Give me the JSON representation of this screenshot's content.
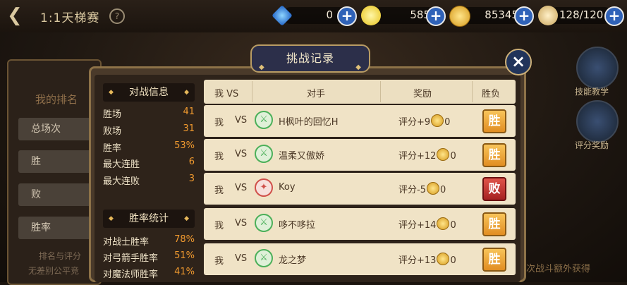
{
  "header": {
    "back_icon": "back-arrow-icon",
    "title": "1:1天梯赛",
    "help_label": "?"
  },
  "resources": [
    {
      "icon": "diamond-icon",
      "value": "0",
      "plus": "+"
    },
    {
      "icon": "energy-swirl-icon",
      "value": "585",
      "plus": "+"
    },
    {
      "icon": "gold-coin-icon",
      "value": "85345",
      "plus": "+"
    },
    {
      "icon": "stamina-flame-icon",
      "value": "128/120",
      "plus": "+"
    }
  ],
  "left_panel": {
    "my_rank": "我的排名",
    "buttons": [
      "总场次",
      "胜",
      "败",
      "胜率"
    ],
    "footer": [
      "排名与评分",
      "无差别公平竞"
    ]
  },
  "right_panel": {
    "skill_label": "技能教学",
    "reward_label": "评分奖励",
    "footer": "次战斗额外获得"
  },
  "modal": {
    "title": "挑战记录",
    "close_label": "×",
    "battle_info": {
      "heading": "对战信息",
      "rows": [
        {
          "label": "胜场",
          "value": "41"
        },
        {
          "label": "败场",
          "value": "31"
        },
        {
          "label": "胜率",
          "value": "53%"
        },
        {
          "label": "最大连胜",
          "value": "6"
        },
        {
          "label": "最大连败",
          "value": "3"
        }
      ]
    },
    "winrate_stats": {
      "heading": "胜率统计",
      "rows": [
        {
          "label": "对战士胜率",
          "value": "78%"
        },
        {
          "label": "对弓箭手胜率",
          "value": "51%"
        },
        {
          "label": "对魔法师胜率",
          "value": "41%"
        }
      ]
    },
    "table": {
      "headers": [
        "我 VS",
        "对手",
        "奖励",
        "胜负"
      ],
      "rows": [
        {
          "me": "我",
          "vs": "VS",
          "class_icon": "warrior-class-icon",
          "opponent": "H枫叶的回忆H",
          "reward_prefix": "评分+9",
          "reward_suffix": "0",
          "result": "胜",
          "result_type": "win"
        },
        {
          "me": "我",
          "vs": "VS",
          "class_icon": "warrior-class-icon",
          "opponent": "温柔又傲娇",
          "reward_prefix": "评分+12",
          "reward_suffix": "0",
          "result": "胜",
          "result_type": "win"
        },
        {
          "me": "我",
          "vs": "VS",
          "class_icon": "mage-class-icon",
          "opponent": "Koy",
          "reward_prefix": "评分-5",
          "reward_suffix": "0",
          "result": "败",
          "result_type": "lose"
        },
        {
          "me": "我",
          "vs": "VS",
          "class_icon": "warrior-class-icon",
          "opponent": "哆不哆拉",
          "reward_prefix": "评分+14",
          "reward_suffix": "0",
          "result": "胜",
          "result_type": "win"
        },
        {
          "me": "我",
          "vs": "VS",
          "class_icon": "warrior-class-icon",
          "opponent": "龙之梦",
          "reward_prefix": "评分+13",
          "reward_suffix": "0",
          "result": "胜",
          "result_type": "win"
        }
      ]
    }
  },
  "colors": {
    "accent_orange": "#f19a2f",
    "win_gold": "#e18d22",
    "lose_red": "#a52121",
    "warrior_green": "#4cb05a",
    "mage_red": "#d0504a"
  }
}
